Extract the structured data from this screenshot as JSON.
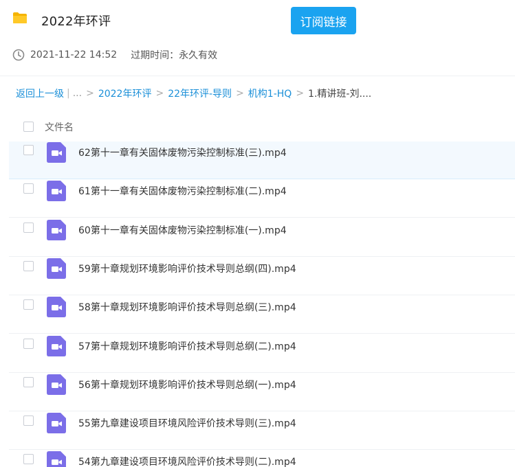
{
  "header": {
    "title": "2022年环评",
    "folder_icon": "folder-icon",
    "subscribe_label": "订阅链接",
    "accent_color": "#1aa3f0"
  },
  "meta": {
    "created": "2021-11-22 14:52",
    "expire": "过期时间：永久有效",
    "clock_icon": "clock-icon"
  },
  "breadcrumb": {
    "back": "返回上一级",
    "ellipsis": "...",
    "items": [
      "2022年环评",
      "22年环评-导则",
      "机构1-HQ"
    ],
    "current": "1.精讲班-刘...."
  },
  "columns": {
    "name": "文件名"
  },
  "files": [
    {
      "name": "62第十一章有关固体废物污染控制标准(三).mp4",
      "icon": "video-file-icon"
    },
    {
      "name": "61第十一章有关固体废物污染控制标准(二).mp4",
      "icon": "video-file-icon"
    },
    {
      "name": "60第十一章有关固体废物污染控制标准(一).mp4",
      "icon": "video-file-icon"
    },
    {
      "name": "59第十章规划环境影响评价技术导则总纲(四).mp4",
      "icon": "video-file-icon"
    },
    {
      "name": "58第十章规划环境影响评价技术导则总纲(三).mp4",
      "icon": "video-file-icon"
    },
    {
      "name": "57第十章规划环境影响评价技术导则总纲(二).mp4",
      "icon": "video-file-icon"
    },
    {
      "name": "56第十章规划环境影响评价技术导则总纲(一).mp4",
      "icon": "video-file-icon"
    },
    {
      "name": "55第九章建设项目环境风险评价技术导则(三).mp4",
      "icon": "video-file-icon"
    },
    {
      "name": "54第九章建设项目环境风险评价技术导则(二).mp4",
      "icon": "video-file-icon"
    }
  ]
}
